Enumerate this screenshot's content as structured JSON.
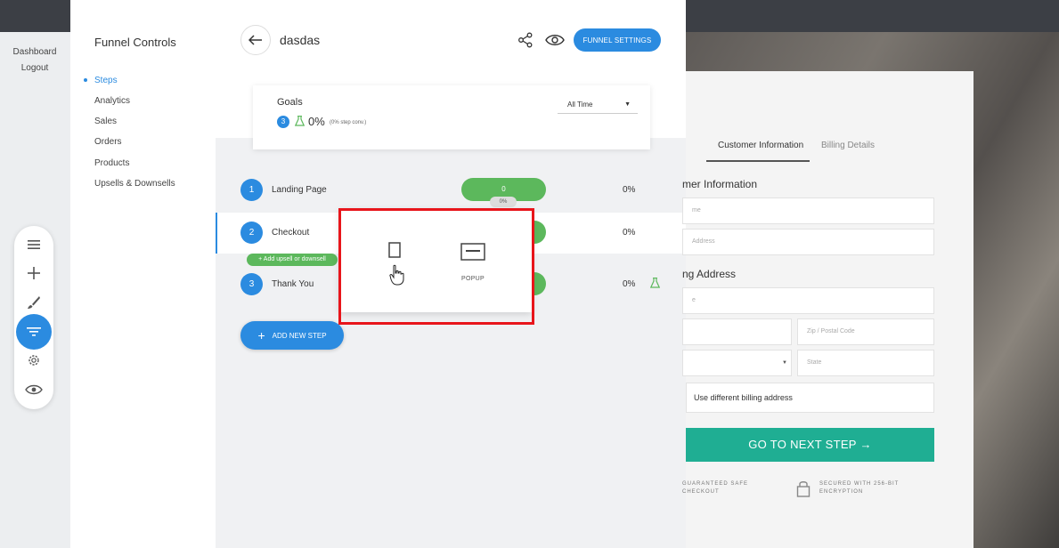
{
  "outer_nav": {
    "items": [
      "Dashboard",
      "Logout"
    ]
  },
  "toolbar": {
    "icons": [
      "list-icon",
      "plus-icon",
      "brush-icon",
      "filter-icon",
      "gear-icon",
      "eye-icon"
    ],
    "accent": "#2b8be0"
  },
  "sidebar": {
    "title": "Funnel Controls",
    "items": [
      {
        "label": "Steps",
        "active": true
      },
      {
        "label": "Analytics"
      },
      {
        "label": "Sales"
      },
      {
        "label": "Orders"
      },
      {
        "label": "Products"
      },
      {
        "label": "Upsells & Downsells"
      }
    ]
  },
  "header": {
    "funnel_name": "dasdas",
    "settings_label": "FUNNEL SETTINGS"
  },
  "goals": {
    "title": "Goals",
    "badge": "3",
    "percent": "0%",
    "conversion": "(0% step conv.)",
    "time_filter": "All Time"
  },
  "steps": [
    {
      "num": "1",
      "name": "Landing Page",
      "count": "0",
      "count_pct": "0%",
      "pct": "0%"
    },
    {
      "num": "2",
      "name": "Checkout",
      "pct": "0%"
    },
    {
      "num": "3",
      "name": "Thank You",
      "pct": "0%"
    }
  ],
  "upsell_label": "+ Add upsell or downsell",
  "add_step_label": "ADD NEW STEP",
  "picker": {
    "popup_label": "POPUP"
  },
  "preview": {
    "tabs": [
      "Customer Information",
      "Billing Details"
    ],
    "heading_customer": "mer Information",
    "field_name": "me",
    "field_address": "Address",
    "heading_shipping": "ng Address",
    "field_street": "e",
    "field_zip": "Zip / Postal Code",
    "field_state": "State",
    "checkbox_label": "Use different billing address",
    "cta": "GO TO NEXT STEP →",
    "secure_1_line1": "GUARANTEED SAFE",
    "secure_1_line2": "CHECKOUT",
    "secure_2_line1": "SECURED WITH 256-BIT",
    "secure_2_line2": "ENCRYPTION"
  },
  "colors": {
    "primary": "#2b8be0",
    "success": "#5cb85c",
    "cta": "#1fae93",
    "highlight": "#e8151b"
  }
}
